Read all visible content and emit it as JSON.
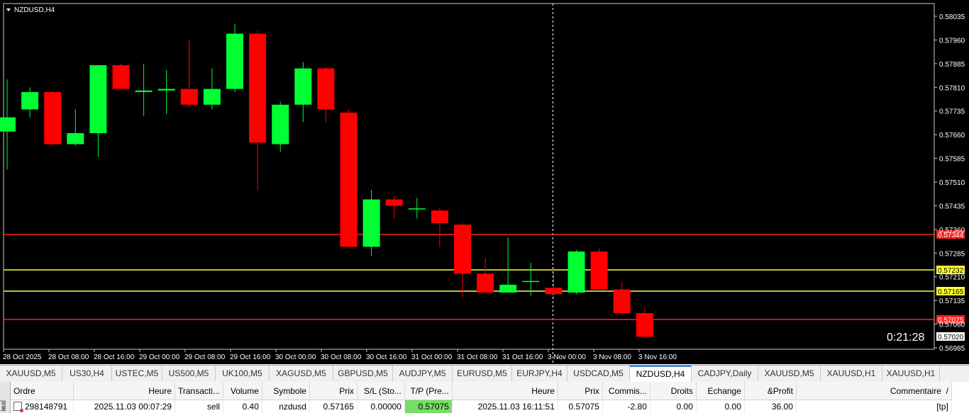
{
  "chart": {
    "symbol_title": "NZDUSD,H4",
    "countdown": "0:21:28",
    "price_min": 0.56985,
    "price_max": 0.58035,
    "price_ticks": [
      "0.58035",
      "0.57960",
      "0.57885",
      "0.57810",
      "0.57735",
      "0.57660",
      "0.57585",
      "0.57510",
      "0.57435",
      "0.57360",
      "0.57285",
      "0.57210",
      "0.57135",
      "0.57060",
      "0.56985"
    ],
    "time_labels": [
      "28 Oct 2025",
      "28 Oct 08:00",
      "28 Oct 16:00",
      "29 Oct 00:00",
      "29 Oct 08:00",
      "29 Oct 16:00",
      "30 Oct 00:00",
      "30 Oct 08:00",
      "30 Oct 16:00",
      "31 Oct 00:00",
      "31 Oct 08:00",
      "31 Oct 16:00",
      "3 Nov 00:00",
      "3 Nov 08:00",
      "3 Nov 16:00"
    ],
    "levels": [
      {
        "price": 0.57344,
        "label": "0.57344",
        "color": "#ff2020",
        "label_bg": "#ff2020",
        "label_fg": "#ffffff"
      },
      {
        "price": 0.57232,
        "label": "0.57232",
        "color": "#ffff33",
        "label_bg": "#ffff33",
        "label_fg": "#000000"
      },
      {
        "price": 0.57165,
        "label": "0.57165",
        "color": "#ffff33",
        "label_bg": "#ffff33",
        "label_fg": "#000000"
      },
      {
        "price": 0.57075,
        "label": "0.57075",
        "color": "#ff2020",
        "label_bg": "#ff2020",
        "label_fg": "#ffffff"
      },
      {
        "price": 0.5702,
        "label": "0.57020",
        "color": "none",
        "label_bg": "#ffffff",
        "label_fg": "#000000"
      }
    ],
    "crosshair_index": 24,
    "colors": {
      "bull": "#00ff33",
      "bear": "#ff0000",
      "background": "#000000",
      "axis": "#ffffff"
    },
    "candles": [
      {
        "o": 0.5767,
        "h": 0.57835,
        "l": 0.5755,
        "c": 0.57715
      },
      {
        "o": 0.5774,
        "h": 0.5781,
        "l": 0.57715,
        "c": 0.57795
      },
      {
        "o": 0.57795,
        "h": 0.578,
        "l": 0.57625,
        "c": 0.5763
      },
      {
        "o": 0.5763,
        "h": 0.5774,
        "l": 0.57625,
        "c": 0.57665
      },
      {
        "o": 0.57665,
        "h": 0.5788,
        "l": 0.5759,
        "c": 0.5788
      },
      {
        "o": 0.5788,
        "h": 0.57885,
        "l": 0.57805,
        "c": 0.57805
      },
      {
        "o": 0.57795,
        "h": 0.57885,
        "l": 0.5772,
        "c": 0.578
      },
      {
        "o": 0.578,
        "h": 0.57865,
        "l": 0.57725,
        "c": 0.57805
      },
      {
        "o": 0.57805,
        "h": 0.5796,
        "l": 0.57745,
        "c": 0.57755
      },
      {
        "o": 0.57755,
        "h": 0.5787,
        "l": 0.5774,
        "c": 0.57805
      },
      {
        "o": 0.57805,
        "h": 0.5801,
        "l": 0.57795,
        "c": 0.5798
      },
      {
        "o": 0.5798,
        "h": 0.5799,
        "l": 0.57485,
        "c": 0.57635
      },
      {
        "o": 0.5763,
        "h": 0.57765,
        "l": 0.57605,
        "c": 0.57755
      },
      {
        "o": 0.57755,
        "h": 0.5789,
        "l": 0.577,
        "c": 0.5787
      },
      {
        "o": 0.5787,
        "h": 0.57875,
        "l": 0.577,
        "c": 0.5774
      },
      {
        "o": 0.5773,
        "h": 0.5774,
        "l": 0.57305,
        "c": 0.57305
      },
      {
        "o": 0.57305,
        "h": 0.57485,
        "l": 0.57275,
        "c": 0.57455
      },
      {
        "o": 0.57455,
        "h": 0.57465,
        "l": 0.57395,
        "c": 0.57435
      },
      {
        "o": 0.57425,
        "h": 0.5746,
        "l": 0.57395,
        "c": 0.57425
      },
      {
        "o": 0.5742,
        "h": 0.5743,
        "l": 0.57305,
        "c": 0.5738
      },
      {
        "o": 0.57375,
        "h": 0.5738,
        "l": 0.57145,
        "c": 0.5722
      },
      {
        "o": 0.5722,
        "h": 0.5727,
        "l": 0.5716,
        "c": 0.5716
      },
      {
        "o": 0.5716,
        "h": 0.57335,
        "l": 0.57165,
        "c": 0.57185
      },
      {
        "o": 0.57195,
        "h": 0.57255,
        "l": 0.5715,
        "c": 0.57195
      },
      {
        "o": 0.57175,
        "h": 0.5724,
        "l": 0.5714,
        "c": 0.57155
      },
      {
        "o": 0.5716,
        "h": 0.57295,
        "l": 0.57155,
        "c": 0.5729
      },
      {
        "o": 0.5729,
        "h": 0.573,
        "l": 0.57165,
        "c": 0.5717
      },
      {
        "o": 0.5717,
        "h": 0.57195,
        "l": 0.5709,
        "c": 0.57095
      },
      {
        "o": 0.57095,
        "h": 0.5711,
        "l": 0.5702,
        "c": 0.5702
      }
    ]
  },
  "tabs": [
    {
      "label": "XAUUSD,M5",
      "active": false
    },
    {
      "label": "US30,H4",
      "active": false
    },
    {
      "label": "USTEC,M5",
      "active": false
    },
    {
      "label": "US500,M5",
      "active": false
    },
    {
      "label": "UK100,M5",
      "active": false
    },
    {
      "label": "XAGUSD,M5",
      "active": false
    },
    {
      "label": "GBPUSD,M5",
      "active": false
    },
    {
      "label": "AUDJPY,M5",
      "active": false
    },
    {
      "label": "EURUSD,M5",
      "active": false
    },
    {
      "label": "EURJPY,H4",
      "active": false
    },
    {
      "label": "USDCAD,M5",
      "active": false
    },
    {
      "label": "NZDUSD,H4",
      "active": true
    },
    {
      "label": "CADJPY,Daily",
      "active": false
    },
    {
      "label": "XAUUSD,M5",
      "active": false
    },
    {
      "label": "XAUUSD,H1",
      "active": false
    },
    {
      "label": "XAUUSD,H1",
      "active": false
    }
  ],
  "terminal": {
    "side_label": "inal",
    "close_glyph": "×",
    "columns": [
      "Ordre",
      "Heure",
      "Transacti...",
      "Volume",
      "Symbole",
      "Prix",
      "S/L (Sto...",
      "T/P (Pre...",
      "Heure",
      "Prix",
      "Commis...",
      "Droits",
      "Echange",
      "&Profit",
      "Commentaire"
    ],
    "sort_glyph": "/",
    "row": {
      "order": "298148791",
      "open_time": "2025.11.03 00:07:29",
      "type": "sell",
      "volume": "0.40",
      "symbol": "nzdusd",
      "price": "0.57165",
      "sl": "0.00000",
      "tp": "0.57075",
      "close_time": "2025.11.03 16:11:51",
      "close_price": "0.57075",
      "commission": "-2.80",
      "swap": "0.00",
      "fee": "0.00",
      "profit": "36.00",
      "comment": "[tp]"
    }
  }
}
